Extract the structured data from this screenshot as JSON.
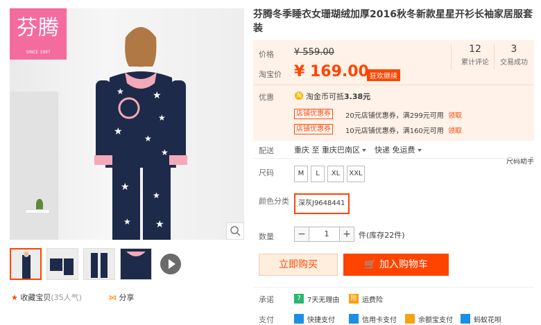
{
  "brand": {
    "name_cn": "芬腾",
    "since": "SINCE 1997"
  },
  "title": "芬腾冬季睡衣女珊瑚绒加厚2016秋冬新款星星开衫长袖家居服套装",
  "price": {
    "orig_label": "价格",
    "orig_value": "¥ 559.00",
    "tb_label": "淘宝价",
    "tb_value": "¥ 169.00",
    "promo_tag": "狂欢继续"
  },
  "stats": [
    {
      "num": "12",
      "label": "累计评论"
    },
    {
      "num": "3",
      "label": "交易成功"
    }
  ],
  "discount": {
    "label": "优惠",
    "coin_icon": "coin-icon",
    "coin_text": "淘金币可抵",
    "coin_value": "3.38元",
    "coupons": [
      {
        "tag": "店铺优惠券",
        "text": "20元店铺优惠券，满299元可用",
        "link": "领取"
      },
      {
        "tag": "店铺优惠券",
        "text": "10元店铺优惠券，满160元可用",
        "link": "领取"
      }
    ]
  },
  "delivery": {
    "label": "配送",
    "from": "重庆 至",
    "to": "重庆巴南区",
    "method": "快递 免运费"
  },
  "size_helper": "尺码助手",
  "size": {
    "label": "尺码",
    "options": [
      "M",
      "L",
      "XL",
      "XXL"
    ]
  },
  "color": {
    "label": "颜色分类",
    "selected": "深灰J9648441"
  },
  "quantity": {
    "label": "数量",
    "minus": "−",
    "value": "1",
    "plus": "+",
    "stock": "件(库存22件)"
  },
  "actions": {
    "buy_now": "立即购买",
    "add_cart": "加入购物车"
  },
  "promise": {
    "label": "承诺",
    "items": [
      {
        "icon": "7",
        "text": "7天无理由"
      },
      {
        "icon": "险",
        "text": "运费险"
      }
    ]
  },
  "payment": {
    "label": "支付",
    "items": [
      "快捷支付",
      "信用卡支付",
      "余额宝支付",
      "蚂蚁花呗"
    ]
  },
  "footer": {
    "fav": "收藏宝贝",
    "fav_count": "(35人气)",
    "share": "分享"
  },
  "colors": {
    "accent": "#ff4400",
    "panel_bg": "#fff2e8",
    "brand_pink": "#f46b9e"
  }
}
